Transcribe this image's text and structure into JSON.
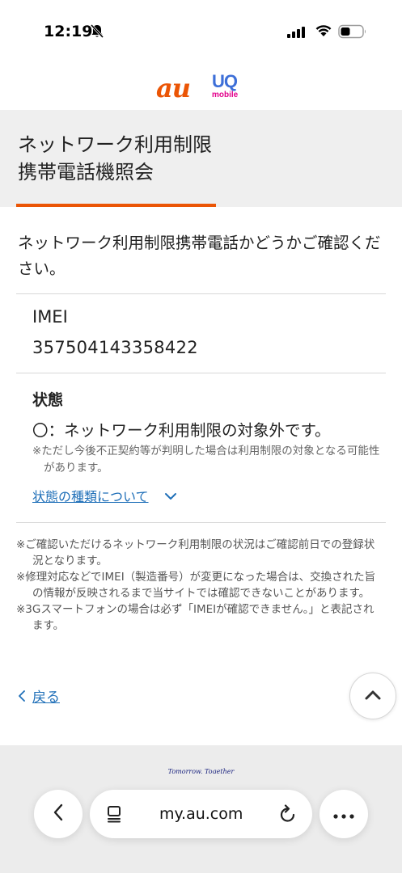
{
  "status_bar": {
    "time": "12:19"
  },
  "header": {
    "logo_primary": "au",
    "logo_secondary": "UQ",
    "logo_secondary_sub": "mobile"
  },
  "page": {
    "title": "ネットワーク利用制限\n携帯電話機照会"
  },
  "main": {
    "intro": "ネットワーク利用制限携帯電話かどうかご確認ください。",
    "imei_label": "IMEI",
    "imei_value": "357504143358422",
    "state_label": "状態",
    "state_value": "〇：ネットワーク利用制限の対象外です。",
    "state_note": "※ただし今後不正契約等が判明した場合は利用制限の対象となる可能性があります。",
    "state_link": "状態の種類について"
  },
  "notes": [
    "※ご確認いただけるネットワーク利用制限の状況はご確認前日での登録状況となります。",
    "※修理対応などでIMEI（製造番号）が変更になった場合は、交換された旨の情報が反映されるまで当サイトでは確認できないことがあります。",
    "※3Gスマートフォンの場合は必ず「IMEIが確認できません。」と表記されます。"
  ],
  "nav": {
    "back_label": "戻る"
  },
  "footer": {
    "tagline": "Tomorrow, Together"
  },
  "browser": {
    "url": "my.au.com"
  },
  "colors": {
    "accent": "#eb5505",
    "link": "#1f6fb8",
    "title_band": "#efefef"
  }
}
